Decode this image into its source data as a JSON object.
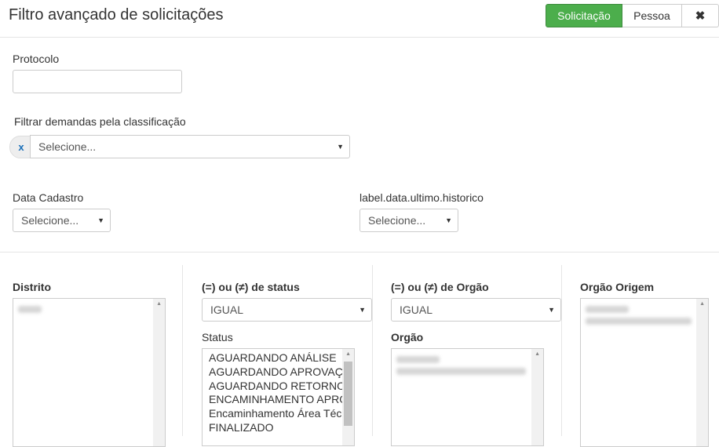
{
  "header": {
    "title": "Filtro avançado de solicitações",
    "buttons": {
      "solicitacao": "Solicitação",
      "pessoa": "Pessoa",
      "close": "✖"
    },
    "accent_color": "#4cae4c"
  },
  "protocolo": {
    "label": "Protocolo",
    "value": "",
    "placeholder": ""
  },
  "classificacao": {
    "label": "Filtrar demandas pela classificação",
    "clear": "x",
    "selected": "Selecione..."
  },
  "data_cadastro": {
    "label": "Data Cadastro",
    "selected": "Selecione..."
  },
  "data_ultimo_historico": {
    "label": "label.data.ultimo.historico",
    "selected": "Selecione..."
  },
  "distrito": {
    "label": "Distrito"
  },
  "status_filter": {
    "op_label": "(=) ou (≠) de status",
    "op_selected": "IGUAL",
    "list_label": "Status",
    "options": [
      "AGUARDANDO ANÁLISE",
      "AGUARDANDO APROVAÇÃO",
      "AGUARDANDO RETORNO",
      "ENCAMINHAMENTO APROVADO",
      "Encaminhamento Área Técnica",
      "FINALIZADO"
    ]
  },
  "orgao_filter": {
    "op_label": "(=) ou (≠) de Orgão",
    "op_selected": "IGUAL",
    "list_label": "Orgão"
  },
  "orgao_origem": {
    "label": "Orgão Origem"
  },
  "icons": {
    "caret": "caret-down-icon",
    "scroll_up": "scroll-up-icon"
  }
}
